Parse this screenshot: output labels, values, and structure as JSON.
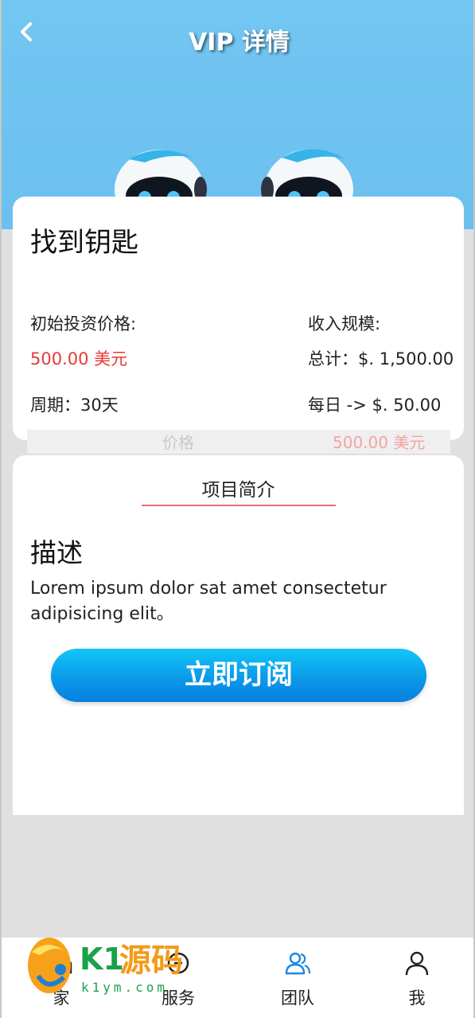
{
  "header": {
    "title": "VIP 详情"
  },
  "product": {
    "name": "找到钥匙",
    "price_label": "初始投资价格:",
    "price_value": "500.00 美元",
    "period": "周期：30天",
    "income_label": "收入规模:",
    "total": "总计：$. 1,500.00",
    "daily": "每日 -> $. 50.00"
  },
  "ghost_row": {
    "left": "价格",
    "right": "500.00 美元"
  },
  "intro": {
    "tab": "项目简介",
    "section_title": "描述",
    "description": "Lorem ipsum dolor sat amet consectetur adipisicing elit。",
    "subscribe_label": "立即订阅"
  },
  "nav": [
    {
      "label": "家",
      "icon": "home-icon"
    },
    {
      "label": "服务",
      "icon": "service-icon"
    },
    {
      "label": "团队",
      "icon": "team-icon"
    },
    {
      "label": "我",
      "icon": "user-icon"
    }
  ],
  "watermark": {
    "brand_k1": "K1",
    "brand_cn": "源码",
    "url": "k1ym.com"
  },
  "colors": {
    "accent": "#0a96e8",
    "price": "#e53935",
    "hero": "#73c6f2"
  }
}
